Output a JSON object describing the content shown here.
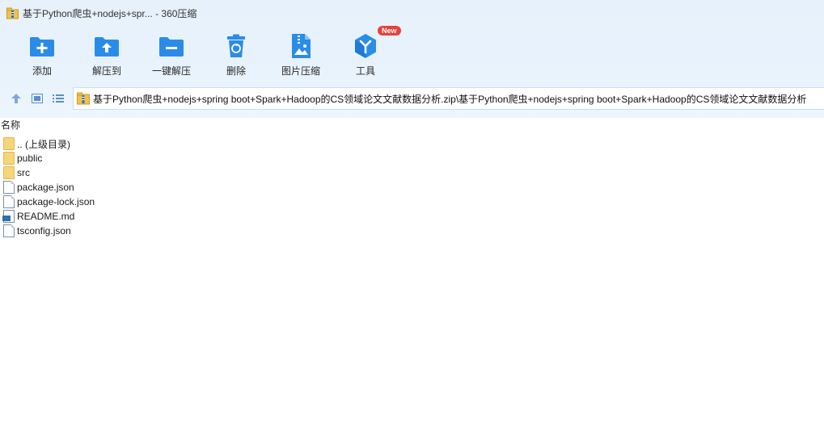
{
  "window": {
    "title": "基于Python爬虫+nodejs+spr... - 360压缩"
  },
  "toolbar": {
    "items": [
      {
        "label": "添加",
        "icon": "add-folder-icon"
      },
      {
        "label": "解压到",
        "icon": "extract-to-icon"
      },
      {
        "label": "一键解压",
        "icon": "one-click-extract-icon"
      },
      {
        "label": "删除",
        "icon": "trash-icon"
      },
      {
        "label": "图片压缩",
        "icon": "image-compress-icon"
      },
      {
        "label": "工具",
        "icon": "tools-icon",
        "badge": "New"
      }
    ]
  },
  "address": {
    "path": "基于Python爬虫+nodejs+spring boot+Spark+Hadoop的CS领域论文文献数据分析.zip\\基于Python爬虫+nodejs+spring boot+Spark+Hadoop的CS领域论文文献数据分析"
  },
  "list": {
    "column_name": "名称",
    "rows": [
      {
        "name": ".. (上级目录)",
        "type": "folder"
      },
      {
        "name": "public",
        "type": "folder"
      },
      {
        "name": "src",
        "type": "folder"
      },
      {
        "name": "package.json",
        "type": "file"
      },
      {
        "name": "package-lock.json",
        "type": "file"
      },
      {
        "name": "README.md",
        "type": "markdown"
      },
      {
        "name": "tsconfig.json",
        "type": "file"
      }
    ]
  },
  "colors": {
    "toolbar_bg": "#e8f2fc",
    "icon_blue": "#2b8ce8",
    "badge_red": "#e8403a",
    "folder_yellow": "#f6d57b"
  }
}
